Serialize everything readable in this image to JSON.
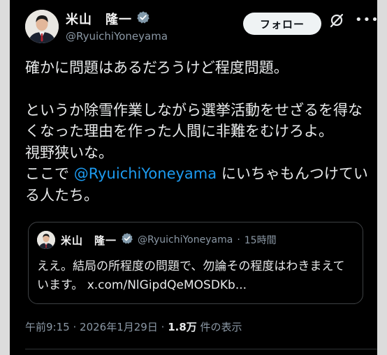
{
  "author": {
    "name": "米山　隆一",
    "handle": "@RyuichiYoneyama"
  },
  "actions": {
    "follow_label": "フォロー"
  },
  "post": {
    "line1": "確かに問題はあるだろうけど程度問題。",
    "line2": "というか除雪作業しながら選挙活動をせざるを得なくなった理由を作った人間に非難をむけろよ。",
    "line3": "視野狭いな。",
    "line4_pre": "ここで ",
    "line4_mention": "@RyuichiYoneyama",
    "line4_post": " にいちゃもんつけている人たち。"
  },
  "quote": {
    "name": "米山　隆一",
    "handle": "@RyuichiYoneyama",
    "separator": "·",
    "time": "15時間",
    "text": "ええ。結局の所程度の問題で、勿論その程度はわきまえています。",
    "link": "x.com/NlGipdQeMOSDKb..."
  },
  "meta": {
    "time": "午前9:15",
    "separator": "·",
    "date": "2026年1月29日",
    "views_count": "1.8万",
    "views_label": "件の表示"
  },
  "colors": {
    "background": "#000000",
    "text": "#e7e9ea",
    "secondary": "#8b98a5",
    "mention": "#1d9bf0",
    "verified": "#829aab"
  }
}
